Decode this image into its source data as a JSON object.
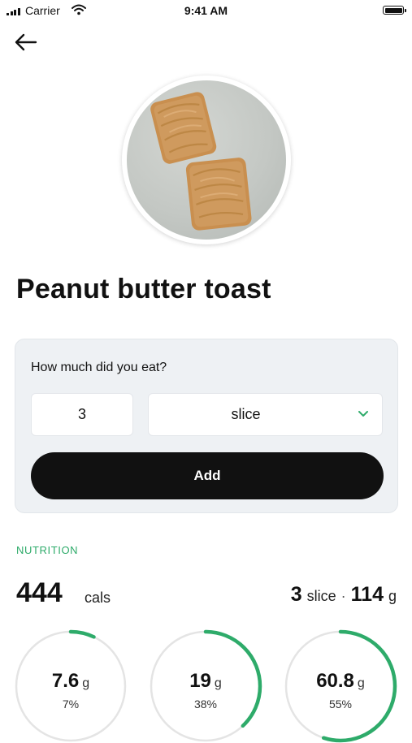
{
  "status_bar": {
    "carrier": "Carrier",
    "time": "9:41 AM"
  },
  "food": {
    "name": "Peanut butter toast"
  },
  "portion": {
    "question": "How much did you eat?",
    "quantity": "3",
    "unit": "slice",
    "add_label": "Add"
  },
  "nutrition": {
    "section_label": "NUTRITION",
    "calories": "444",
    "calories_unit": "cals",
    "serving_qty": "3",
    "serving_unit": "slice",
    "separator": "·",
    "weight_value": "114",
    "weight_unit": "g",
    "macros": [
      {
        "amount": "7.6",
        "unit": "g",
        "percent_label": "7%",
        "fraction": 0.07
      },
      {
        "amount": "19",
        "unit": "g",
        "percent_label": "38%",
        "fraction": 0.38
      },
      {
        "amount": "60.8",
        "unit": "g",
        "percent_label": "55%",
        "fraction": 0.55
      }
    ]
  },
  "colors": {
    "accent": "#2eab6a",
    "ring_track": "#e4e4e4",
    "button": "#111111"
  }
}
